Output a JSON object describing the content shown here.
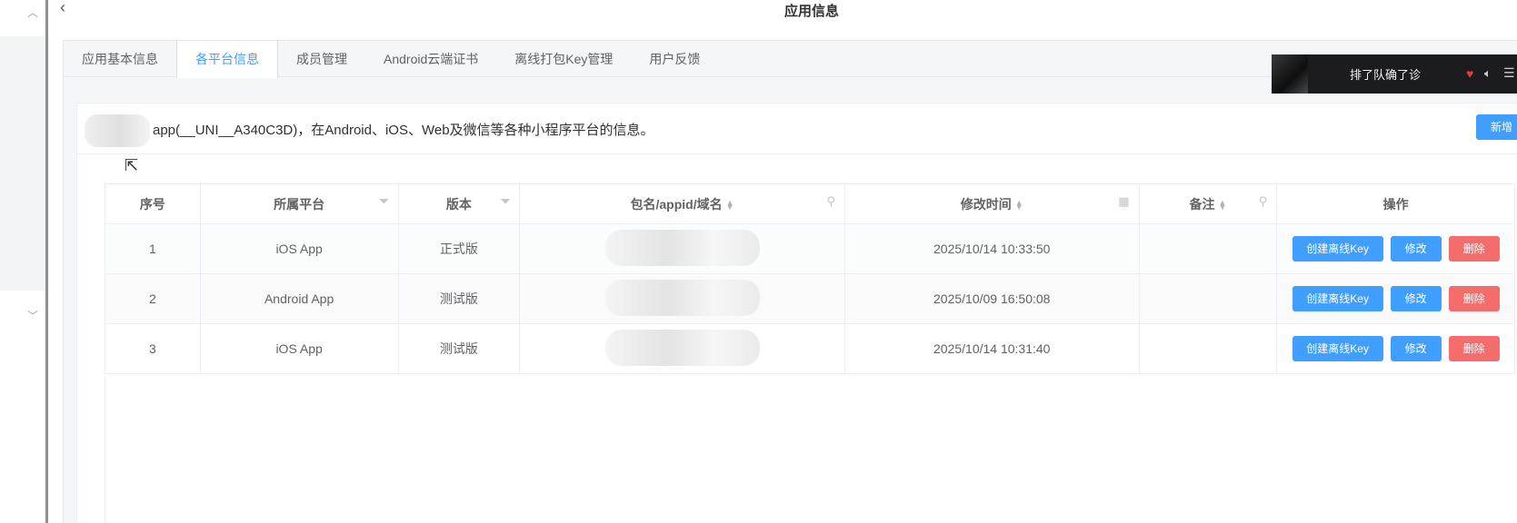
{
  "header": {
    "title": "应用信息",
    "back_icon": "chevron-left-icon"
  },
  "tabs": [
    {
      "label": "应用基本信息",
      "active": false
    },
    {
      "label": "各平台信息",
      "active": true
    },
    {
      "label": "成员管理",
      "active": false
    },
    {
      "label": "Android云端证书",
      "active": false
    },
    {
      "label": "离线打包Key管理",
      "active": false
    },
    {
      "label": "用户反馈",
      "active": false
    }
  ],
  "info": {
    "text": "app(__UNI__A340C3D)，在Android、iOS、Web及微信等各种小程序平台的信息。",
    "add_label": "新增"
  },
  "table": {
    "columns": [
      "序号",
      "所属平台",
      "版本",
      "包名/appid/域名",
      "修改时间",
      "备注",
      "操作"
    ],
    "rows": [
      {
        "index": "1",
        "platform": "iOS App",
        "version": "正式版",
        "modified": "2025/10/14 10:33:50",
        "remark": ""
      },
      {
        "index": "2",
        "platform": "Android App",
        "version": "测试版",
        "modified": "2025/10/09 16:50:08",
        "remark": ""
      },
      {
        "index": "3",
        "platform": "iOS App",
        "version": "测试版",
        "modified": "2025/10/14 10:31:40",
        "remark": ""
      }
    ],
    "actions": {
      "create_key": "创建离线Key",
      "edit": "修改",
      "delete": "删除"
    }
  },
  "music": {
    "title": "排了队确了诊"
  },
  "colors": {
    "primary": "#409eff",
    "danger": "#f56c6c",
    "active_tab": "#409eff"
  }
}
